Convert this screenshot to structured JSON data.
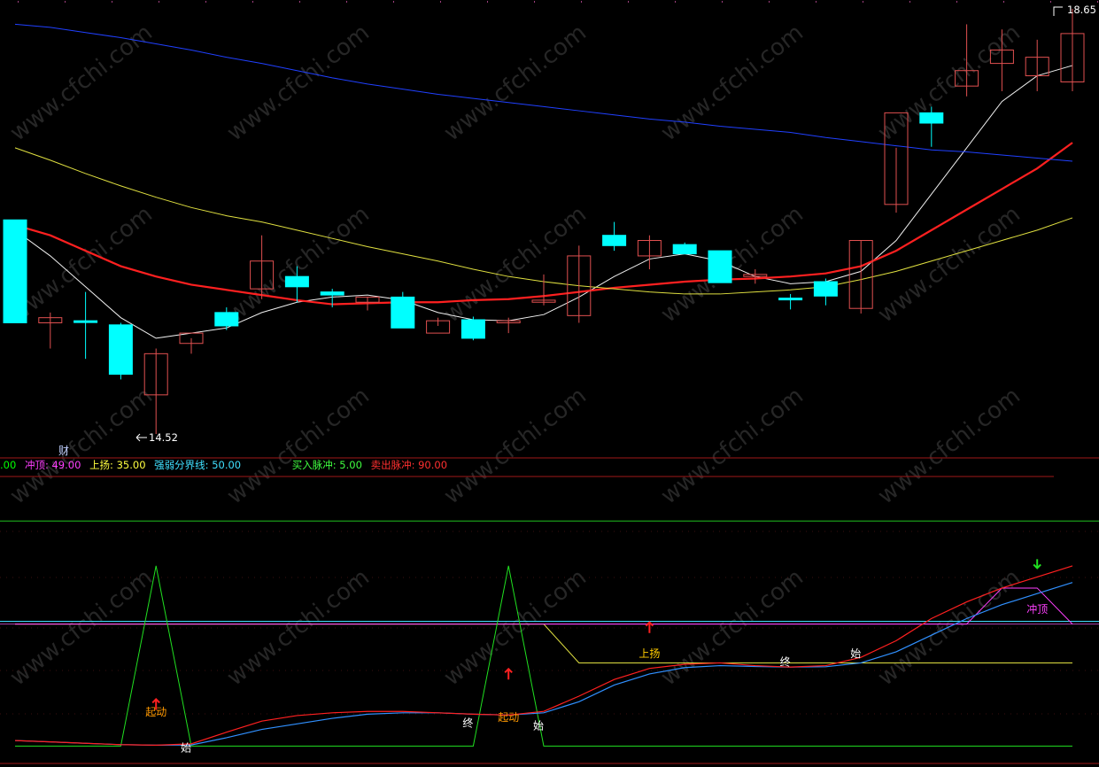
{
  "watermark": "www.cfchi.com",
  "colors": {
    "background": "#000000",
    "up_candle": "#e05050",
    "down_candle": "#00ffff",
    "ma_white": "#f0f0f0",
    "ma_red": "#ff2020",
    "ma_yellow": "#e0e040",
    "ma_blue": "#2040ff",
    "divider": "#a01818"
  },
  "price_panel": {
    "high_label": "18.65",
    "low_label": "14.52",
    "marker_text": "财"
  },
  "indicator_legend": [
    {
      "text": ".00",
      "color": "#00ff00"
    },
    {
      "text": "冲顶: 49.00",
      "color": "#ff40ff"
    },
    {
      "text": "上扬: 35.00",
      "color": "#ffff40"
    },
    {
      "text": "强弱分界线: 50.00",
      "color": "#40e0ff"
    },
    {
      "text": "买入脉冲: 5.00",
      "color": "#40ff40"
    },
    {
      "text": "卖出脉冲: 90.00",
      "color": "#ff3030"
    }
  ],
  "chart_data": {
    "type": "candlestick",
    "price_range": [
      14.52,
      18.65
    ],
    "candles": [
      {
        "o": 16.6,
        "h": 16.6,
        "l": 15.6,
        "c": 15.6,
        "dir": "down"
      },
      {
        "o": 15.6,
        "h": 15.7,
        "l": 15.35,
        "c": 15.65,
        "dir": "up"
      },
      {
        "o": 15.62,
        "h": 15.9,
        "l": 15.25,
        "c": 15.62,
        "dir": "down"
      },
      {
        "o": 15.58,
        "h": 15.6,
        "l": 15.05,
        "c": 15.1,
        "dir": "down"
      },
      {
        "o": 14.9,
        "h": 15.35,
        "l": 14.52,
        "c": 15.3,
        "dir": "up"
      },
      {
        "o": 15.4,
        "h": 15.45,
        "l": 15.3,
        "c": 15.5,
        "dir": "up"
      },
      {
        "o": 15.7,
        "h": 15.75,
        "l": 15.53,
        "c": 15.57,
        "dir": "down"
      },
      {
        "o": 15.93,
        "h": 16.45,
        "l": 15.83,
        "c": 16.2,
        "dir": "up"
      },
      {
        "o": 16.05,
        "h": 16.15,
        "l": 15.8,
        "c": 15.95,
        "dir": "down"
      },
      {
        "o": 15.9,
        "h": 15.93,
        "l": 15.75,
        "c": 15.87,
        "dir": "down"
      },
      {
        "o": 15.8,
        "h": 15.85,
        "l": 15.72,
        "c": 15.85,
        "dir": "up"
      },
      {
        "o": 15.85,
        "h": 15.9,
        "l": 15.59,
        "c": 15.55,
        "dir": "down"
      },
      {
        "o": 15.5,
        "h": 15.65,
        "l": 15.57,
        "c": 15.62,
        "dir": "up"
      },
      {
        "o": 15.63,
        "h": 15.66,
        "l": 15.43,
        "c": 15.45,
        "dir": "down"
      },
      {
        "o": 15.6,
        "h": 15.65,
        "l": 15.5,
        "c": 15.62,
        "dir": "up"
      },
      {
        "o": 15.8,
        "h": 16.07,
        "l": 15.77,
        "c": 15.82,
        "dir": "up"
      },
      {
        "o": 15.67,
        "h": 16.35,
        "l": 15.6,
        "c": 16.25,
        "dir": "up"
      },
      {
        "o": 16.45,
        "h": 16.58,
        "l": 16.3,
        "c": 16.35,
        "dir": "down"
      },
      {
        "o": 16.25,
        "h": 16.45,
        "l": 16.12,
        "c": 16.4,
        "dir": "up"
      },
      {
        "o": 16.36,
        "h": 16.38,
        "l": 16.27,
        "c": 16.27,
        "dir": "down"
      },
      {
        "o": 16.3,
        "h": 16.3,
        "l": 16.08,
        "c": 15.99,
        "dir": "down"
      },
      {
        "o": 16.05,
        "h": 16.12,
        "l": 15.98,
        "c": 16.07,
        "dir": "up"
      },
      {
        "o": 15.84,
        "h": 15.88,
        "l": 15.73,
        "c": 15.84,
        "dir": "down"
      },
      {
        "o": 16.0,
        "h": 16.03,
        "l": 15.77,
        "c": 15.86,
        "dir": "down"
      },
      {
        "o": 15.74,
        "h": 16.4,
        "l": 15.69,
        "c": 16.4,
        "dir": "up"
      },
      {
        "o": 16.75,
        "h": 17.3,
        "l": 16.67,
        "c": 17.64,
        "dir": "up"
      },
      {
        "o": 17.64,
        "h": 17.7,
        "l": 17.31,
        "c": 17.54,
        "dir": "down"
      },
      {
        "o": 17.9,
        "h": 18.5,
        "l": 17.8,
        "c": 18.05,
        "dir": "up"
      },
      {
        "o": 18.12,
        "h": 18.45,
        "l": 17.85,
        "c": 18.25,
        "dir": "up"
      },
      {
        "o": 18.0,
        "h": 18.35,
        "l": 17.85,
        "c": 18.18,
        "dir": "up"
      },
      {
        "o": 17.94,
        "h": 18.65,
        "l": 17.85,
        "c": 18.41,
        "dir": "up"
      }
    ],
    "moving_averages": [
      {
        "name": "MA-white",
        "color": "#f0f0f0",
        "values": [
          16.5,
          16.25,
          15.95,
          15.65,
          15.45,
          15.5,
          15.55,
          15.7,
          15.8,
          15.85,
          15.87,
          15.82,
          15.7,
          15.63,
          15.62,
          15.68,
          15.85,
          16.05,
          16.22,
          16.27,
          16.2,
          16.05,
          15.98,
          16.0,
          16.1,
          16.4,
          16.85,
          17.3,
          17.75,
          18.0,
          18.1
        ]
      },
      {
        "name": "MA-red",
        "color": "#ff2020",
        "values": [
          16.55,
          16.45,
          16.3,
          16.15,
          16.05,
          15.97,
          15.92,
          15.87,
          15.82,
          15.78,
          15.79,
          15.8,
          15.8,
          15.82,
          15.83,
          15.86,
          15.9,
          15.94,
          15.97,
          16.0,
          16.02,
          16.03,
          16.05,
          16.08,
          16.15,
          16.3,
          16.5,
          16.7,
          16.9,
          17.1,
          17.35
        ]
      },
      {
        "name": "MA-yellow",
        "color": "#e0e040",
        "values": [
          17.3,
          17.18,
          17.05,
          16.93,
          16.82,
          16.72,
          16.64,
          16.58,
          16.5,
          16.42,
          16.34,
          16.27,
          16.2,
          16.12,
          16.05,
          16.0,
          15.96,
          15.93,
          15.9,
          15.88,
          15.88,
          15.9,
          15.92,
          15.95,
          16.02,
          16.1,
          16.2,
          16.3,
          16.4,
          16.5,
          16.62
        ]
      },
      {
        "name": "MA-blue",
        "color": "#2040ff",
        "values": [
          18.5,
          18.47,
          18.42,
          18.37,
          18.31,
          18.25,
          18.18,
          18.12,
          18.05,
          17.98,
          17.92,
          17.87,
          17.82,
          17.78,
          17.74,
          17.7,
          17.66,
          17.62,
          17.58,
          17.55,
          17.51,
          17.48,
          17.45,
          17.4,
          17.36,
          17.32,
          17.28,
          17.26,
          17.23,
          17.2,
          17.17
        ]
      }
    ],
    "indicator": {
      "range": [
        0,
        100
      ],
      "levels": [
        {
          "name": "卖出脉冲",
          "value": 90,
          "color": "#ff3030"
        },
        {
          "name": "冲顶",
          "value": 49,
          "color": "#ff40ff"
        },
        {
          "name": "上扬",
          "value": 35,
          "color": "#ffff40"
        },
        {
          "name": "强弱分界线",
          "value": 50,
          "color": "#40e0ff"
        },
        {
          "name": "买入脉冲",
          "value": 5,
          "color": "#40ff40"
        }
      ],
      "red_line": [
        7,
        6.5,
        6,
        5.5,
        5.3,
        5.8,
        10,
        14,
        16,
        17,
        17.5,
        17.5,
        17,
        16.5,
        16.2,
        17.5,
        23,
        29,
        33,
        34.5,
        35,
        34,
        33.5,
        34,
        37,
        43,
        51,
        57,
        62,
        66,
        70
      ],
      "blue_line": [
        7,
        6.5,
        6,
        5.5,
        5.3,
        5.4,
        8,
        11,
        13,
        15,
        16.5,
        17,
        17,
        16.5,
        16.2,
        17,
        21,
        27,
        31,
        33.3,
        34,
        33.7,
        33.5,
        33.6,
        35,
        39,
        45,
        51,
        56,
        60,
        64
      ],
      "green_line": [
        5,
        5,
        5,
        5,
        70,
        5,
        5,
        5,
        5,
        5,
        5,
        5,
        5,
        5,
        70,
        5,
        5,
        5,
        5,
        5,
        5,
        5,
        5,
        5,
        5,
        5,
        5,
        5,
        5,
        5,
        5
      ],
      "yellow_line": [
        49,
        49,
        49,
        49,
        49,
        49,
        49,
        49,
        49,
        49,
        49,
        49,
        49,
        49,
        49,
        49,
        35,
        35,
        35,
        35,
        35,
        35,
        35,
        35,
        35,
        35,
        35,
        35,
        35,
        35,
        35
      ],
      "magenta_line": [
        49,
        49,
        49,
        49,
        49,
        49,
        49,
        49,
        49,
        49,
        49,
        49,
        49,
        49,
        49,
        49,
        49,
        49,
        49,
        49,
        49,
        49,
        49,
        49,
        49,
        49,
        49,
        49,
        62,
        62,
        49
      ],
      "annotations": [
        {
          "idx": 4,
          "text": "起动",
          "color": "#ff9900",
          "y": 16
        },
        {
          "idx": 5,
          "text": "始",
          "color": "#ffffff",
          "y": 3
        },
        {
          "idx": 13,
          "text": "终",
          "color": "#ffffff",
          "y": 12
        },
        {
          "idx": 14,
          "text": "起动",
          "color": "#ff9900",
          "y": 14
        },
        {
          "idx": 15,
          "text": "始",
          "color": "#ffffff",
          "y": 11
        },
        {
          "idx": 18,
          "text": "上扬",
          "color": "#ffcc00",
          "y": 37
        },
        {
          "idx": 22,
          "text": "终",
          "color": "#ffffff",
          "y": 34
        },
        {
          "idx": 24,
          "text": "始",
          "color": "#ffffff",
          "y": 37
        },
        {
          "idx": 29,
          "text": "冲顶",
          "color": "#ff40ff",
          "y": 53
        }
      ],
      "up_arrows": [
        4,
        14,
        18
      ],
      "down_arrows": [
        29
      ]
    }
  }
}
